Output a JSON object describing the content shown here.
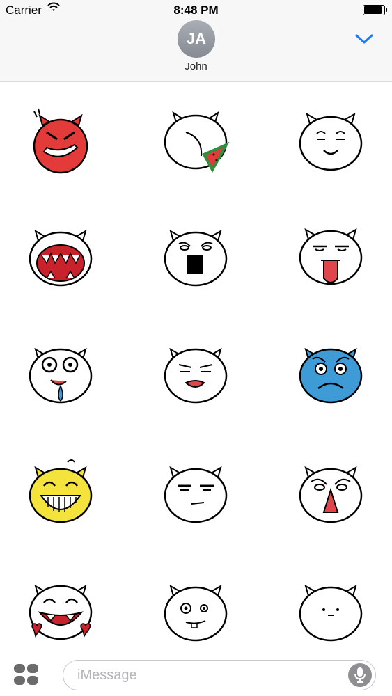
{
  "status_bar": {
    "carrier": "Carrier",
    "time": "8:48 PM"
  },
  "conversation": {
    "avatar_initials": "JA",
    "contact_name": "John"
  },
  "stickers": [
    {
      "name": "red-devil-grin-sticker"
    },
    {
      "name": "watermelon-eating-sticker"
    },
    {
      "name": "smiling-calm-sticker"
    },
    {
      "name": "screaming-teeth-sticker"
    },
    {
      "name": "shocked-open-mouth-sticker"
    },
    {
      "name": "tongue-out-sticker"
    },
    {
      "name": "crazy-drooling-sticker"
    },
    {
      "name": "unimpressed-lip-sticker"
    },
    {
      "name": "blue-sad-sticker"
    },
    {
      "name": "yellow-laughing-sticker"
    },
    {
      "name": "straight-face-sticker"
    },
    {
      "name": "worried-red-nose-sticker"
    },
    {
      "name": "love-laughing-sticker"
    },
    {
      "name": "crazy-eyes-sticker"
    },
    {
      "name": "blank-face-sticker"
    }
  ],
  "input": {
    "placeholder": "iMessage",
    "value": ""
  },
  "icons": {
    "wifi": "wifi-icon",
    "battery": "battery-icon",
    "collapse": "chevron-down-icon",
    "apps": "app-drawer-icon",
    "mic": "microphone-icon"
  },
  "colors": {
    "accent": "#1a7cf5",
    "devil_red": "#e33a3a",
    "sad_blue": "#3f9bd6",
    "laugh_yellow": "#f5e33d",
    "tongue_red": "#e0454b"
  }
}
